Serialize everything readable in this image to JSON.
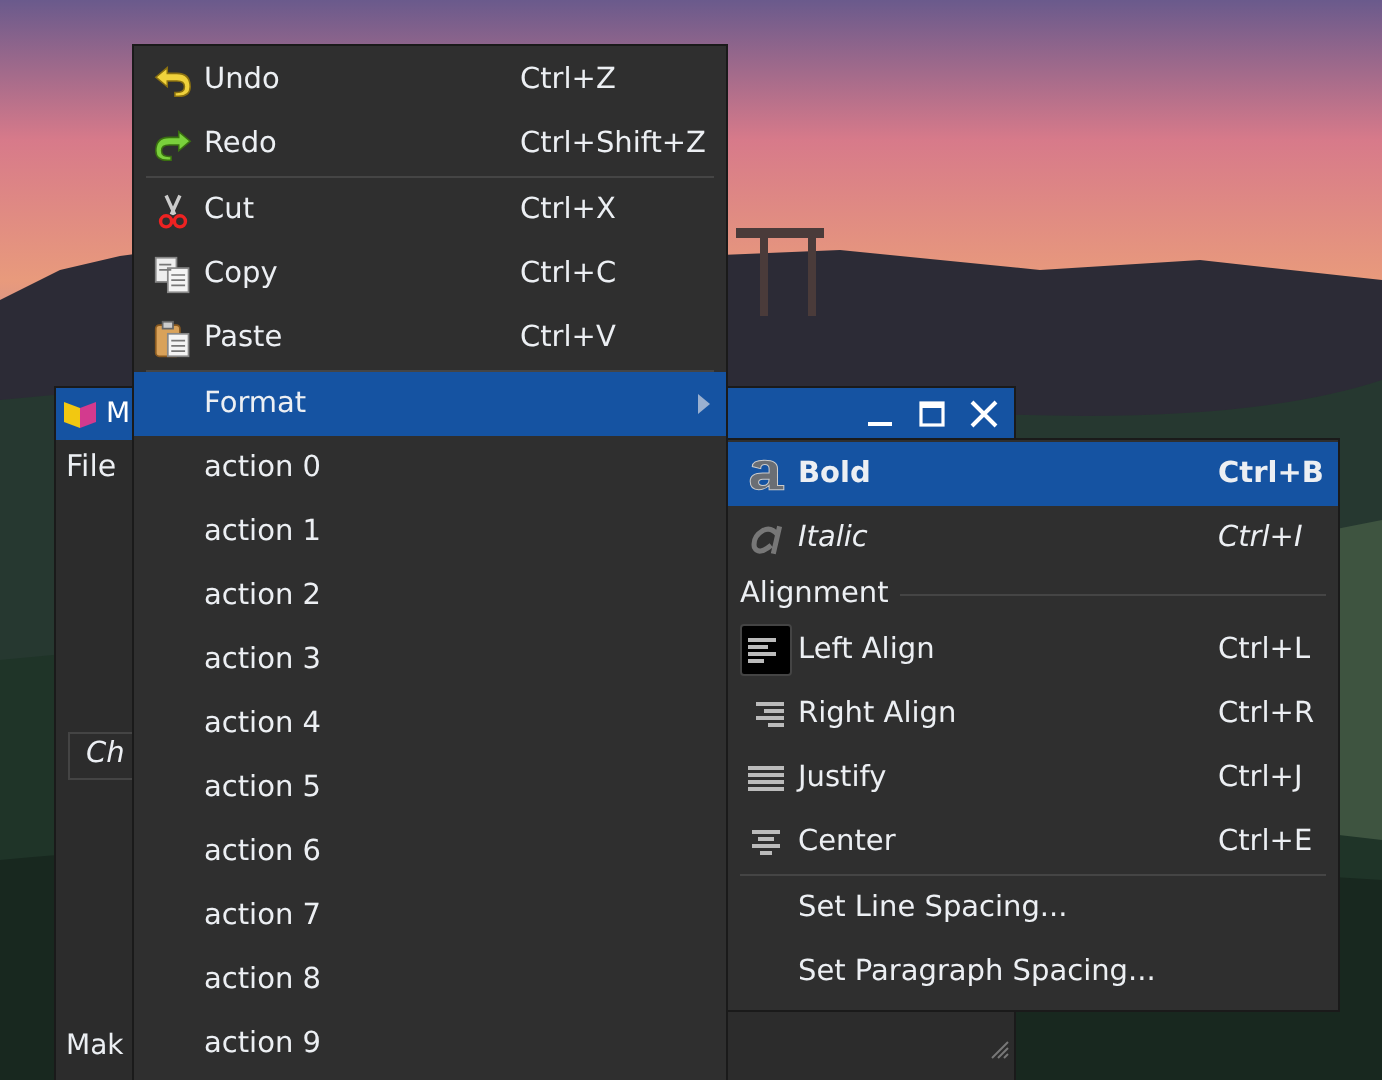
{
  "window": {
    "title": "M",
    "menu": [
      {
        "label": "File"
      }
    ],
    "combo": {
      "placeholder": "Ch"
    },
    "footer": "Mak"
  },
  "context_menu": {
    "items": [
      {
        "kind": "action",
        "label": "Undo",
        "shortcut": "Ctrl+Z",
        "selected": false
      },
      {
        "kind": "action",
        "label": "Redo",
        "shortcut": "Ctrl+Shift+Z",
        "selected": false
      },
      {
        "kind": "separator"
      },
      {
        "kind": "action",
        "label": "Cut",
        "shortcut": "Ctrl+X",
        "selected": false
      },
      {
        "kind": "action",
        "label": "Copy",
        "shortcut": "Ctrl+C",
        "selected": false
      },
      {
        "kind": "action",
        "label": "Paste",
        "shortcut": "Ctrl+V",
        "selected": false
      },
      {
        "kind": "separator"
      },
      {
        "kind": "submenu",
        "label": "Format",
        "selected": true
      },
      {
        "kind": "action",
        "label": "action 0",
        "selected": false
      },
      {
        "kind": "action",
        "label": "action 1",
        "selected": false
      },
      {
        "kind": "action",
        "label": "action 2",
        "selected": false
      },
      {
        "kind": "action",
        "label": "action 3",
        "selected": false
      },
      {
        "kind": "action",
        "label": "action 4",
        "selected": false
      },
      {
        "kind": "action",
        "label": "action 5",
        "selected": false
      },
      {
        "kind": "action",
        "label": "action 6",
        "selected": false
      },
      {
        "kind": "action",
        "label": "action 7",
        "selected": false
      },
      {
        "kind": "action",
        "label": "action 8",
        "selected": false
      },
      {
        "kind": "action",
        "label": "action 9",
        "selected": false
      }
    ]
  },
  "submenu": {
    "items": [
      {
        "kind": "bold",
        "label": "Bold",
        "shortcut": "Ctrl+B",
        "selected": true
      },
      {
        "kind": "italic",
        "label": "Italic",
        "shortcut": "Ctrl+I",
        "selected": false
      },
      {
        "kind": "section",
        "label": "Alignment"
      },
      {
        "kind": "action",
        "label": "Left Align",
        "shortcut": "Ctrl+L",
        "checked": true,
        "selected": false
      },
      {
        "kind": "action",
        "label": "Right Align",
        "shortcut": "Ctrl+R",
        "checked": false,
        "selected": false
      },
      {
        "kind": "action",
        "label": "Justify",
        "shortcut": "Ctrl+J",
        "checked": false,
        "selected": false
      },
      {
        "kind": "action",
        "label": "Center",
        "shortcut": "Ctrl+E",
        "checked": false,
        "selected": false
      },
      {
        "kind": "separator"
      },
      {
        "kind": "action",
        "label": "Set Line Spacing...",
        "selected": false
      },
      {
        "kind": "action",
        "label": "Set Paragraph Spacing...",
        "selected": false
      }
    ]
  }
}
